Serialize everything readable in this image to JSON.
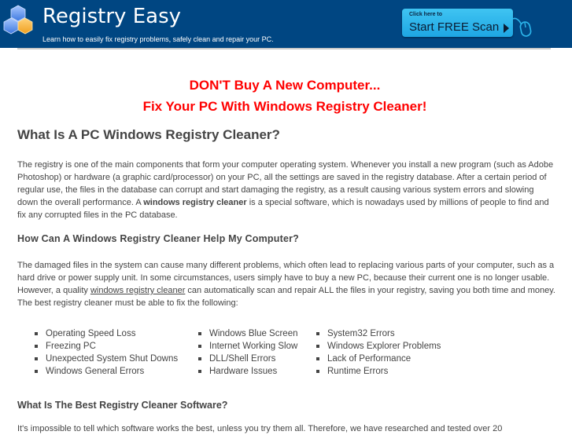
{
  "header": {
    "site_title": "Registry Easy",
    "tagline": "Learn how to easily fix registry problems, safely clean and repair your PC.",
    "logo_icon": "hexagon-cluster-icon",
    "scan_button": {
      "small_label": "Click here to",
      "label": "Start FREE Scan",
      "icon": "play-arrow-icon"
    },
    "mouse_icon": "computer-mouse-icon",
    "colors": {
      "background": "#004682",
      "button": "#2cb6ec"
    }
  },
  "promo": {
    "line1": "DON'T Buy A New Computer...",
    "line2": "Fix Your PC With Windows Registry Cleaner!",
    "color": "#ff0000"
  },
  "section1": {
    "heading": "What Is A PC Windows Registry Cleaner?",
    "para_before": "The registry is one of the main components that form your computer operating system. Whenever you install a new program (such as Adobe Photoshop) or hardware (a graphic card/processor) on your PC, all the settings are saved in the registry database. After a certain period of regular use, the files in the database can corrupt and start damaging the registry, as a result causing various system errors and slowing down the overall performance. A ",
    "para_bold": "windows registry cleaner",
    "para_after": " is a special software, which is nowadays used by millions of people to find and fix any corrupted files in the PC database."
  },
  "section2": {
    "heading": "How Can A Windows Registry Cleaner Help My Computer?",
    "para_before": "The damaged files in the system can cause many different problems, which often lead to replacing various parts of your computer, such as a hard drive or power supply unit. In some circumstances, users simply have to buy a new PC, because their current one is no longer usable. However, a quality ",
    "para_link": "windows registry cleaner",
    "para_after": " can automatically scan and repair ALL the files in your registry, saving you both time and money. The best registry cleaner must be able to fix the following:",
    "list_col1": [
      "Operating Speed Loss",
      "Freezing PC",
      "Unexpected System Shut Downs",
      "Windows General Errors"
    ],
    "list_col2": [
      "Windows Blue Screen",
      "Internet Working Slow",
      "DLL/Shell Errors",
      "Hardware Issues"
    ],
    "list_col3": [
      "System32 Errors",
      "Windows Explorer Problems",
      "Lack of Performance",
      "Runtime Errors"
    ]
  },
  "section3": {
    "heading": "What Is The Best Registry Cleaner Software?",
    "para": "It's impossible to tell which software works the best, unless you try them all. Therefore, we have researched and tested over 20"
  }
}
